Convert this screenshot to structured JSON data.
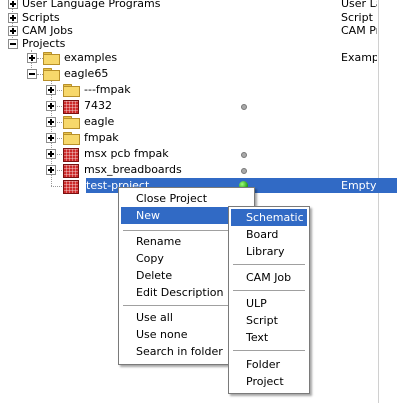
{
  "tree": {
    "items": [
      {
        "label": "User Language Programs",
        "desc": "User La"
      },
      {
        "label": "Scripts",
        "desc": "Script F"
      },
      {
        "label": "CAM Jobs",
        "desc": "CAM Pro"
      },
      {
        "label": "Projects",
        "desc": ""
      },
      {
        "label": "examples",
        "desc": "Example"
      },
      {
        "label": "eagle65",
        "desc": ""
      },
      {
        "label": "---fmpak",
        "desc": ""
      },
      {
        "label": "7432",
        "desc": ""
      },
      {
        "label": "eagle",
        "desc": ""
      },
      {
        "label": "fmpak",
        "desc": ""
      },
      {
        "label": "msx pcb fmpak",
        "desc": ""
      },
      {
        "label": "msx_breadboards",
        "desc": ""
      },
      {
        "label": "test-project",
        "desc": "Empty P"
      }
    ]
  },
  "context_menu": {
    "items": [
      "Close Project",
      "New",
      "Rename",
      "Copy",
      "Delete",
      "Edit Description",
      "Use all",
      "Use none",
      "Search in folder"
    ]
  },
  "new_submenu": {
    "items": [
      "Schematic",
      "Board",
      "Library",
      "CAM Job",
      "ULP",
      "Script",
      "Text",
      "Folder",
      "Project"
    ]
  },
  "colors": {
    "selection": "#316ac5",
    "folder": "#f7d86b",
    "project_icon": "#cc2a2a",
    "active_dot": "#1d9a12"
  }
}
